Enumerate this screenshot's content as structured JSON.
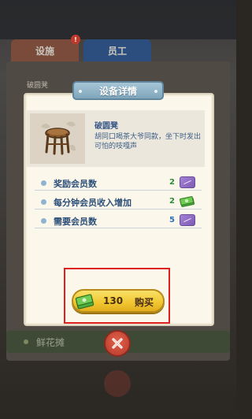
{
  "background": {
    "tabs": [
      {
        "label": "设施"
      },
      {
        "label": "员工"
      }
    ],
    "tab_badge": "!",
    "row_label": "破圆凳",
    "bottom_row_label": "鲜花摊"
  },
  "dialog": {
    "title": "设备详情",
    "item": {
      "name": "破圆凳",
      "description": "胡同口喝茶大爷同款，坐下时发出可怕的吱嘎声"
    },
    "stats": [
      {
        "label": "奖励会员数",
        "value": "2",
        "icon": "ticket-icon",
        "value_color": "#2f8a3a"
      },
      {
        "label": "每分钟会员收入增加",
        "value": "2",
        "icon": "cash-icon",
        "value_color": "#2f8a3a"
      },
      {
        "label": "需要会员数",
        "value": "5",
        "icon": "ticket-icon",
        "value_color": "#2f8a3a"
      }
    ],
    "buy_button": {
      "price": "130",
      "label": "购买"
    },
    "close_icon": "close-icon"
  },
  "colors": {
    "highlight": "#e02020",
    "accent_blue": "#2c4f7a",
    "button_gold": "#f2c933"
  }
}
